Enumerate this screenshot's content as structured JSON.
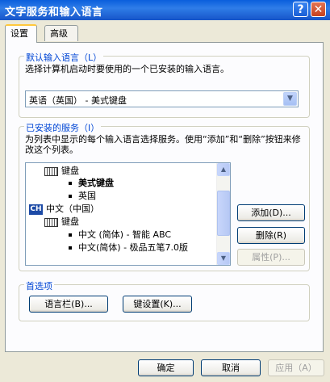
{
  "window": {
    "title": "文字服务和输入语言"
  },
  "title_buttons": {
    "help": "?",
    "close": "✕"
  },
  "tabs": [
    {
      "label": "设置"
    },
    {
      "label": "高级"
    }
  ],
  "default_language": {
    "group_title": "默认输入语言（L）",
    "description": "选择计算机启动时要使用的一个已安装的输入语言。",
    "selected": "英语（英国） - 美式键盘"
  },
  "installed_services": {
    "group_title": "已安装的服务（I）",
    "description": "为列表中显示的每个输入语言选择服务。使用“添加”和“删除”按钮来修改这个列表。",
    "tree": [
      {
        "kind": "category",
        "icon": "keyboard-icon",
        "label": "键盘"
      },
      {
        "kind": "item",
        "label": "美式键盘"
      },
      {
        "kind": "item",
        "label": "英国"
      },
      {
        "kind": "language",
        "icon": "CH",
        "label": "中文（中国）"
      },
      {
        "kind": "category",
        "icon": "keyboard-icon",
        "label": "键盘"
      },
      {
        "kind": "item",
        "label": "中文 (简体) - 智能 ABC"
      },
      {
        "kind": "item",
        "label": "中文(简体) - 极品五笔7.0版"
      }
    ],
    "buttons": {
      "add": "添加(D)...",
      "remove": "删除(R)",
      "properties": "属性(P)..."
    }
  },
  "preferences": {
    "group_title": "首选项",
    "language_bar_button": "语言栏(B)...",
    "key_settings_button": "键设置(K)..."
  },
  "footer": {
    "ok": "确定",
    "cancel": "取消",
    "apply": "应用（A）"
  },
  "colors": {
    "title_bar": "#0a5fdc",
    "group_title": "#0046d5",
    "dialog_bg": "#ece9d8"
  }
}
